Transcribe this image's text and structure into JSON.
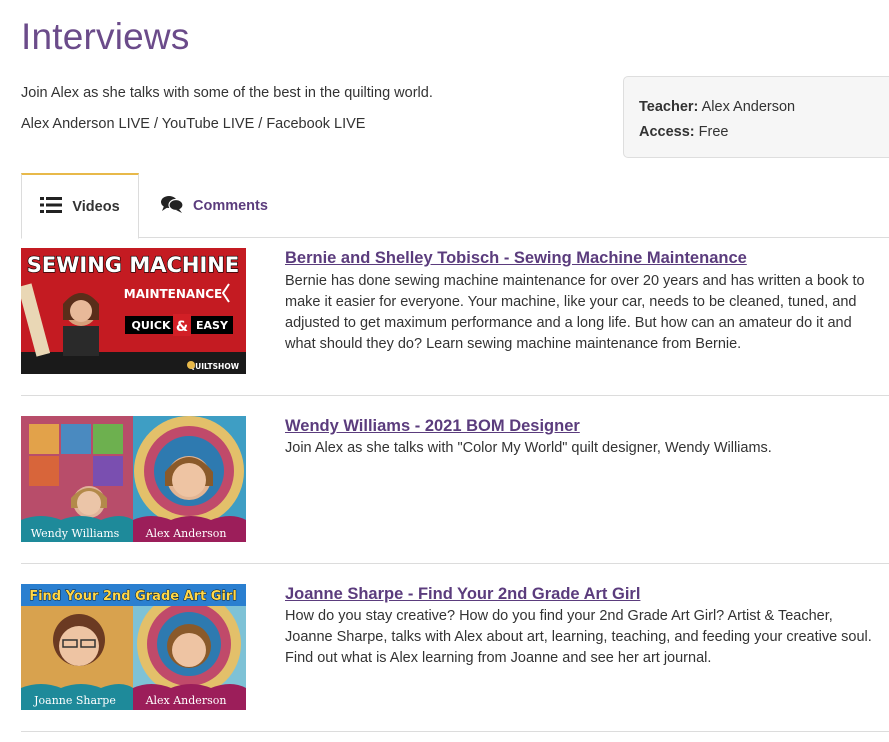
{
  "page": {
    "title": "Interviews",
    "intro_line1": "Join Alex as she talks with some of the best in the quilting world.",
    "intro_line2": "Alex Anderson LIVE / YouTube LIVE / Facebook LIVE"
  },
  "info": {
    "teacher_label": "Teacher:",
    "teacher_value": "Alex Anderson",
    "access_label": "Access:",
    "access_value": "Free"
  },
  "tabs": [
    {
      "label": "Videos",
      "icon": "list-icon",
      "active": true
    },
    {
      "label": "Comments",
      "icon": "comments-icon",
      "active": false
    }
  ],
  "videos": [
    {
      "title": "Bernie and Shelley Tobisch - Sewing Machine Maintenance",
      "description": "Bernie has done sewing machine maintenance for over 20 years and has written a book to make it easier for everyone. Your machine, like your car, needs to be cleaned, tuned, and adjusted to get maximum performance and a long life. But how can an amateur do it and what should they do? Learn sewing machine maintenance from Bernie.",
      "thumb": {
        "headline": "SEWING MACHINE",
        "sub": "MAINTENANCE",
        "quick": "QUICK",
        "amp": "&",
        "easy": "EASY",
        "logo": "QUILTSHOW"
      }
    },
    {
      "title": "Wendy Williams - 2021 BOM Designer",
      "description": "Join Alex as she talks with \"Color My World\" quilt designer, Wendy Williams.",
      "thumb": {
        "name_left": "Wendy Williams",
        "name_right": "Alex Anderson"
      }
    },
    {
      "title": "Joanne Sharpe - Find Your 2nd Grade Art Girl",
      "description": "How do you stay creative? How do you find your 2nd Grade Art Girl? Artist & Teacher, Joanne Sharpe, talks with Alex about art, learning, teaching, and feeding your creative soul. Find out what is Alex learning from Joanne and see her art journal.",
      "thumb": {
        "banner": "Find Your 2nd Grade Art Girl",
        "name_left": "Joanne Sharpe",
        "name_right": "Alex Anderson"
      }
    }
  ],
  "colors": {
    "accent": "#6b4b8a",
    "link": "#5b3c7d",
    "tab_active_border": "#e8b94a"
  }
}
